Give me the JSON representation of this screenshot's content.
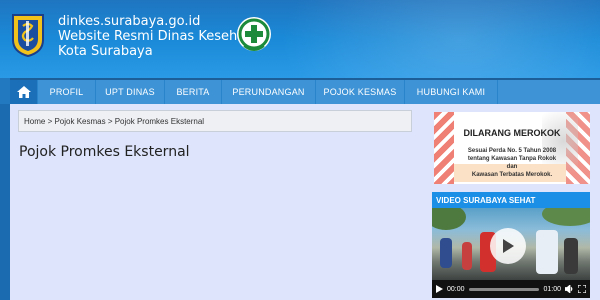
{
  "header": {
    "domain": "dinkes.surabaya.go.id",
    "title": "Website Resmi Dinas Kesehatan",
    "city": "Kota Surabaya",
    "crest_icon": "surabaya-crest-icon",
    "logo_icon": "bakti-husada-logo-icon"
  },
  "nav": {
    "home_icon": "home-icon",
    "items": [
      "PROFIL",
      "UPT DINAS",
      "BERITA",
      "PERUNDANGAN",
      "POJOK KESMAS",
      "HUBUNGI KAMI"
    ]
  },
  "breadcrumb": "Home > Pojok Kesmas > Pojok Promkes Eksternal",
  "page_title": "Pojok Promkes Eksternal",
  "sidebar": {
    "banner": {
      "heading": "DILARANG MEROKOK",
      "line1": "Sesuai Perda No. 5 Tahun 2008",
      "line2": "tentang Kawasan Tanpa Rokok",
      "line3": "dan",
      "line4": "Kawasan Terbatas Merokok."
    },
    "video": {
      "heading": "VIDEO SURABAYA SEHAT",
      "time_current": "00:00",
      "time_total": "01:00"
    }
  },
  "colors": {
    "header_blue": "#1a8ad8",
    "nav_blue": "#3d93d6",
    "content_bg": "#dde4fb",
    "video_header": "#1b8fe6"
  }
}
